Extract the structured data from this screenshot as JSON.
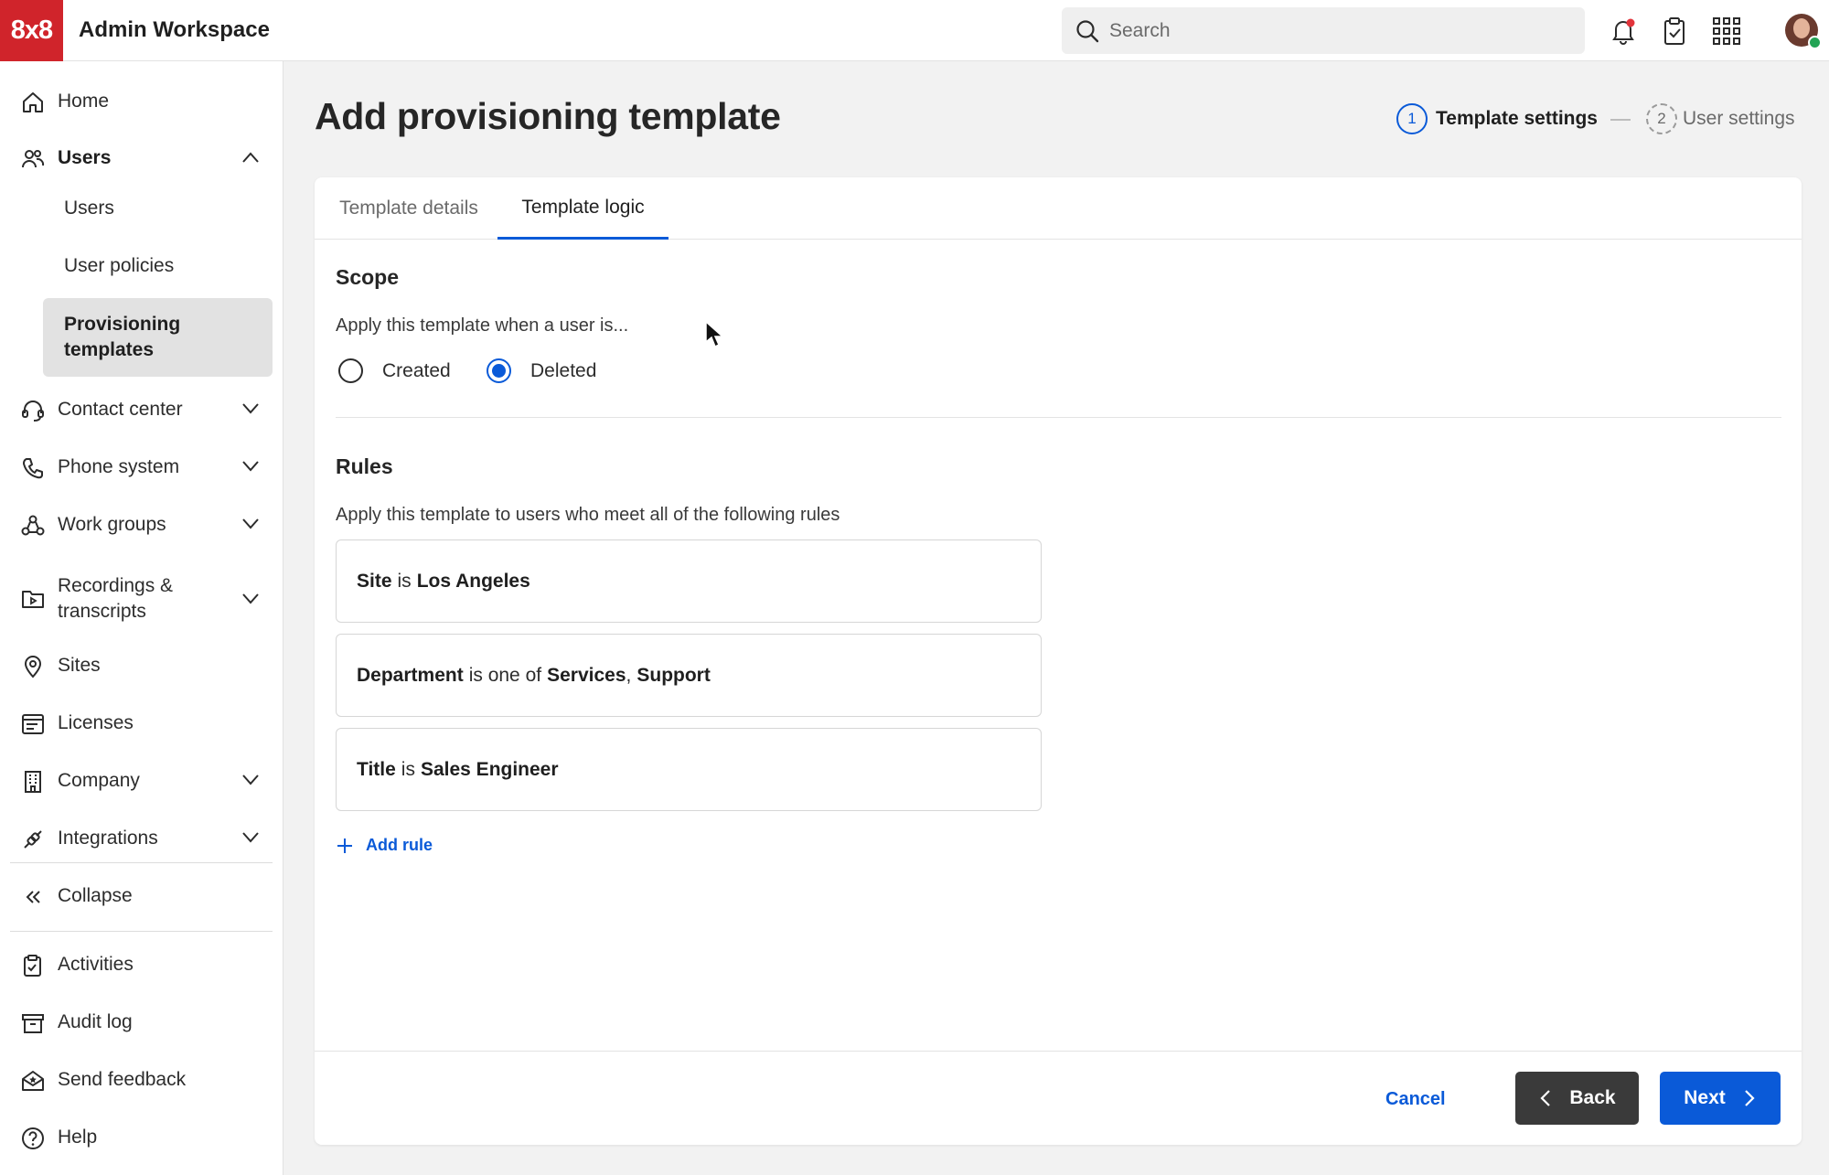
{
  "app": {
    "logo_text": "8x8",
    "title": "Admin Workspace"
  },
  "search": {
    "placeholder": "Search"
  },
  "sidebar": {
    "items": [
      {
        "label": "Home",
        "icon": "home-icon"
      },
      {
        "label": "Users",
        "icon": "users-icon",
        "expanded": true
      },
      {
        "label": "Contact center",
        "icon": "headset-icon"
      },
      {
        "label": "Phone system",
        "icon": "phone-icon"
      },
      {
        "label": "Work groups",
        "icon": "work-groups-icon"
      },
      {
        "label": "Recordings & transcripts",
        "icon": "recordings-icon"
      },
      {
        "label": "Sites",
        "icon": "location-pin-icon"
      },
      {
        "label": "Licenses",
        "icon": "licenses-icon"
      },
      {
        "label": "Company",
        "icon": "building-icon"
      },
      {
        "label": "Integrations",
        "icon": "integrations-icon"
      }
    ],
    "users_subitems": [
      {
        "label": "Users"
      },
      {
        "label": "User policies"
      },
      {
        "label": "Provisioning templates",
        "active": true
      }
    ],
    "collapse_label": "Collapse",
    "bottom_items": [
      {
        "label": "Activities",
        "icon": "activities-icon"
      },
      {
        "label": "Audit log",
        "icon": "archive-icon"
      },
      {
        "label": "Send feedback",
        "icon": "feedback-icon"
      },
      {
        "label": "Help",
        "icon": "help-icon"
      }
    ]
  },
  "page": {
    "title": "Add provisioning template",
    "steps": [
      {
        "number": "1",
        "label": "Template settings",
        "state": "active"
      },
      {
        "number": "2",
        "label": "User settings",
        "state": "pending"
      }
    ],
    "tabs": [
      {
        "label": "Template details",
        "active": false
      },
      {
        "label": "Template logic",
        "active": true
      }
    ]
  },
  "scope": {
    "title": "Scope",
    "description": "Apply this template when a user is...",
    "options": [
      {
        "label": "Created",
        "checked": false
      },
      {
        "label": "Deleted",
        "checked": true
      }
    ]
  },
  "rules": {
    "title": "Rules",
    "description": "Apply this template to users who meet all of the following rules",
    "items": [
      {
        "field": "Site",
        "operator": "is",
        "values": [
          "Los Angeles"
        ]
      },
      {
        "field": "Department",
        "operator": "is one of",
        "values": [
          "Services",
          "Support"
        ]
      },
      {
        "field": "Title",
        "operator": "is",
        "values": [
          "Sales Engineer"
        ]
      }
    ],
    "add_rule_label": "Add rule"
  },
  "footer": {
    "cancel_label": "Cancel",
    "back_label": "Back",
    "next_label": "Next"
  },
  "colors": {
    "brand": "#d0242b",
    "accent": "#0a5ad8",
    "dark_button": "#3a3a3a"
  }
}
